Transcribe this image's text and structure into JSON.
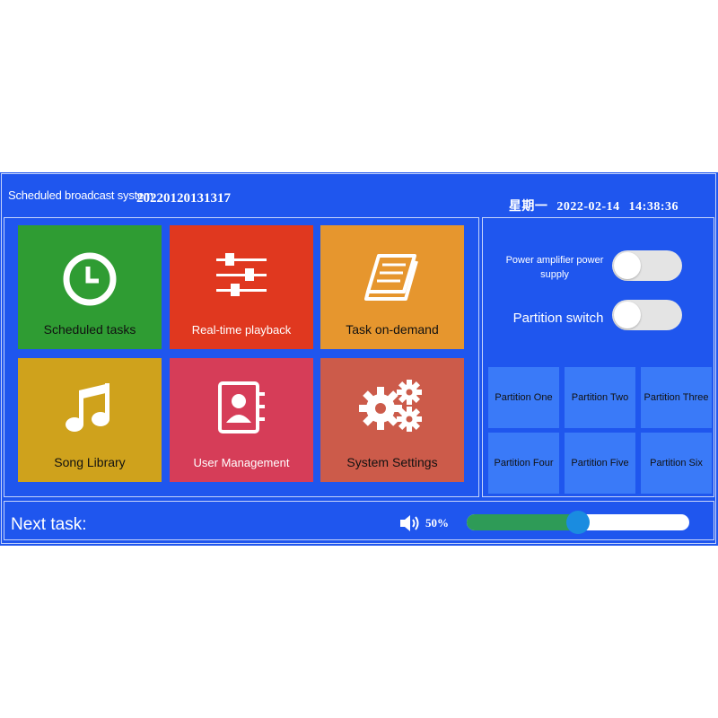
{
  "header": {
    "app_title": "Scheduled broadcast system",
    "serial": "20220120131317",
    "weekday": "星期一",
    "date": "2022-02-14",
    "time": "14:38:36"
  },
  "tiles": [
    {
      "label": "Scheduled tasks",
      "icon": "clock-icon",
      "color": "#2f9c33"
    },
    {
      "label": "Real-time playback",
      "icon": "sliders-icon",
      "color": "#e0381f"
    },
    {
      "label": "Task on-demand",
      "icon": "book-icon",
      "color": "#e6962e"
    },
    {
      "label": "Song Library",
      "icon": "music-note-icon",
      "color": "#cfa21c"
    },
    {
      "label": "User Management",
      "icon": "contact-card-icon",
      "color": "#d63d58"
    },
    {
      "label": "System Settings",
      "icon": "gears-icon",
      "color": "#cc5b4a"
    }
  ],
  "side_panel": {
    "power_label": "Power amplifier power supply",
    "partition_switch_label": "Partition switch",
    "partitions": [
      "Partition One",
      "Partition Two",
      "Partition Three",
      "Partition Four",
      "Partition Five",
      "Partition Six"
    ]
  },
  "footer": {
    "next_task_label": "Next task:",
    "volume_percent": "50%",
    "volume_level": 0.5,
    "speaker_icon": "speaker-icon"
  },
  "colors": {
    "background": "#1f56ee",
    "partition_button": "#3a7af8",
    "slider_fill": "#2e9b57",
    "slider_thumb": "#1a8ce0"
  }
}
